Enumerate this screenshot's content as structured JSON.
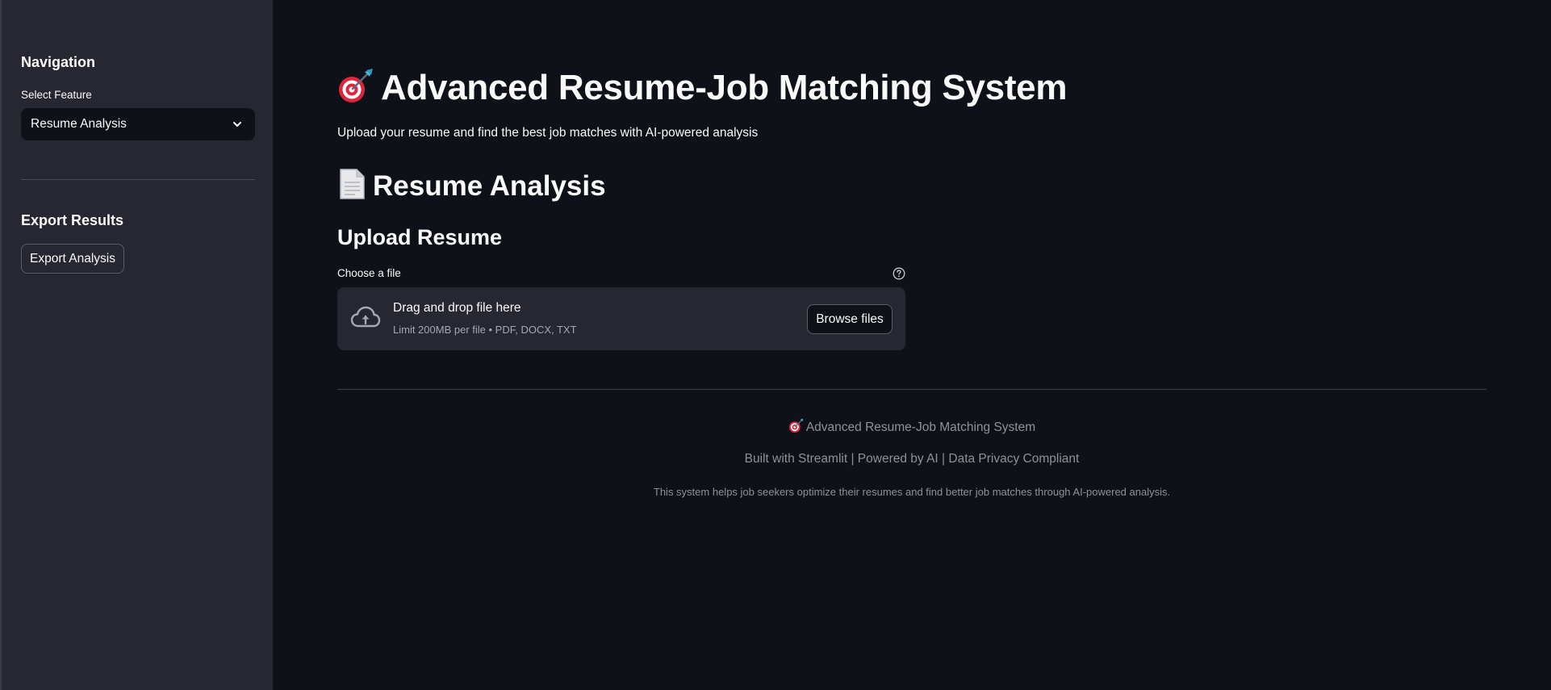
{
  "sidebar": {
    "navigation_heading": "Navigation",
    "select_label": "Select Feature",
    "select_value": "Resume Analysis",
    "export_heading": "Export Results",
    "export_button": "Export Analysis"
  },
  "main": {
    "title": "Advanced Resume-Job Matching System",
    "title_icon": "target-dart-icon",
    "subtitle": "Upload your resume and find the best job matches with AI-powered analysis",
    "section_title": "Resume Analysis",
    "section_icon": "document-icon",
    "upload_heading": "Upload Resume",
    "file_label": "Choose a file",
    "dropzone": {
      "title": "Drag and drop file here",
      "limit": "Limit 200MB per file • PDF, DOCX, TXT",
      "browse_button": "Browse files"
    }
  },
  "footer": {
    "title": "Advanced Resume-Job Matching System",
    "built": "Built with Streamlit | Powered by AI | Data Privacy Compliant",
    "description": "This system helps job seekers optimize their resumes and find better job matches through AI-powered analysis."
  },
  "colors": {
    "background": "#0e1117",
    "sidebar": "#262730",
    "text": "#fafafa",
    "muted": "#8d919b",
    "target_red": "#e0243b",
    "dart_blue": "#4fb8d8"
  }
}
